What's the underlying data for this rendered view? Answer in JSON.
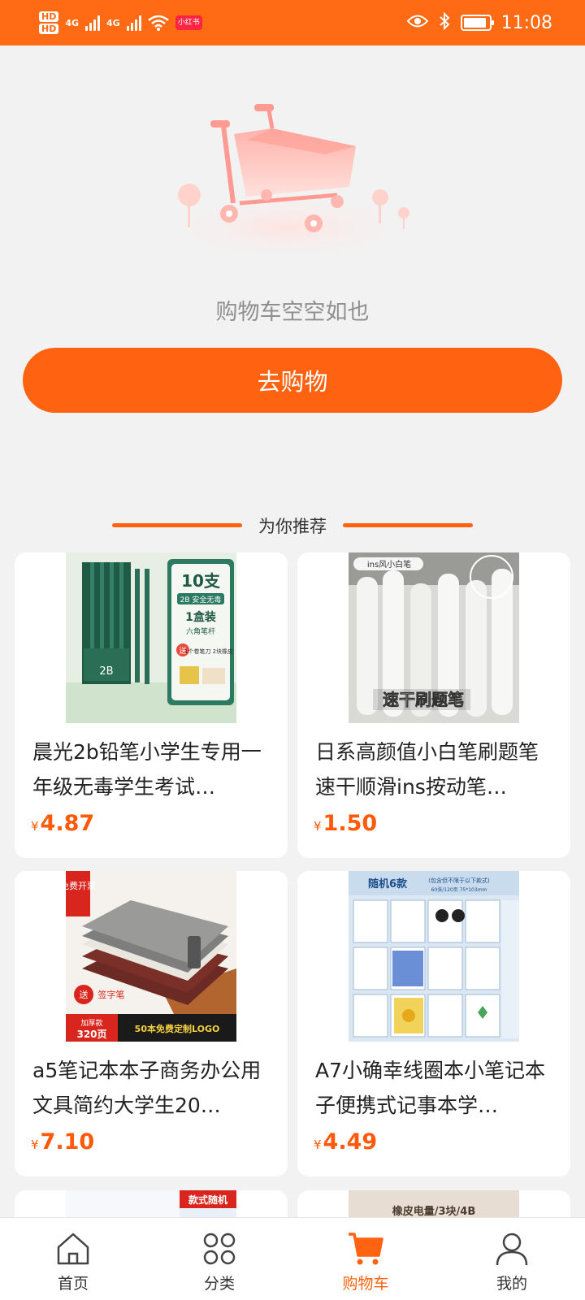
{
  "status_bar": {
    "hd_badges": [
      "HD",
      "HD"
    ],
    "network": [
      "4G",
      "4G"
    ],
    "app_badge": "小红书",
    "time": "11:08"
  },
  "empty_cart": {
    "message": "购物车空空如也",
    "button_label": "去购物"
  },
  "recommend": {
    "heading": "为你推荐",
    "products": [
      {
        "title": "晨光2b铅笔小学生专用一年级无毒学生考试…",
        "currency": "¥",
        "price": "4.87",
        "image_text": {
          "count": "10支",
          "spec": "2B 安全无毒",
          "box": "1盒装",
          "shape": "六角笔杆",
          "gift": "送",
          "gift_detail": "1个卷笔刀 2块橡皮",
          "grade": "2B"
        }
      },
      {
        "title": "日系高颜值小白笔刷题笔速干顺滑ins按动笔…",
        "currency": "¥",
        "price": "1.50",
        "image_text": {
          "tag": "ins风小白笔",
          "slogan": "速干刷题笔"
        }
      },
      {
        "title": "a5笔记本本子商务办公用文具简约大学生20…",
        "currency": "¥",
        "price": "7.10",
        "image_text": {
          "corner": "免费开票",
          "gift": "送",
          "gift_item": "签字笔",
          "pages_label": "加厚款",
          "pages": "320页",
          "custom": "50本免费定制LOGO"
        }
      },
      {
        "title": "A7小确幸线圈本小笔记本子便携式记事本学…",
        "currency": "¥",
        "price": "4.49",
        "image_text": {
          "headline": "随机6款",
          "note": "(包含但不限于以下款式)",
          "spec": "60张/120页 75*103mm"
        }
      }
    ],
    "partial_cards": [
      {
        "image_text": "款式随机"
      },
      {
        "image_text": "橡皮电量/3块/4B"
      }
    ]
  },
  "tab_bar": {
    "tabs": [
      {
        "label": "首页",
        "icon": "home-icon",
        "active": false
      },
      {
        "label": "分类",
        "icon": "category-icon",
        "active": false
      },
      {
        "label": "购物车",
        "icon": "cart-icon",
        "active": true
      },
      {
        "label": "我的",
        "icon": "user-icon",
        "active": false
      }
    ]
  },
  "colors": {
    "brand": "#ff6312",
    "status_bar": "#ff6a14",
    "price": "#ff5a0a",
    "background": "#f2f2f2"
  }
}
